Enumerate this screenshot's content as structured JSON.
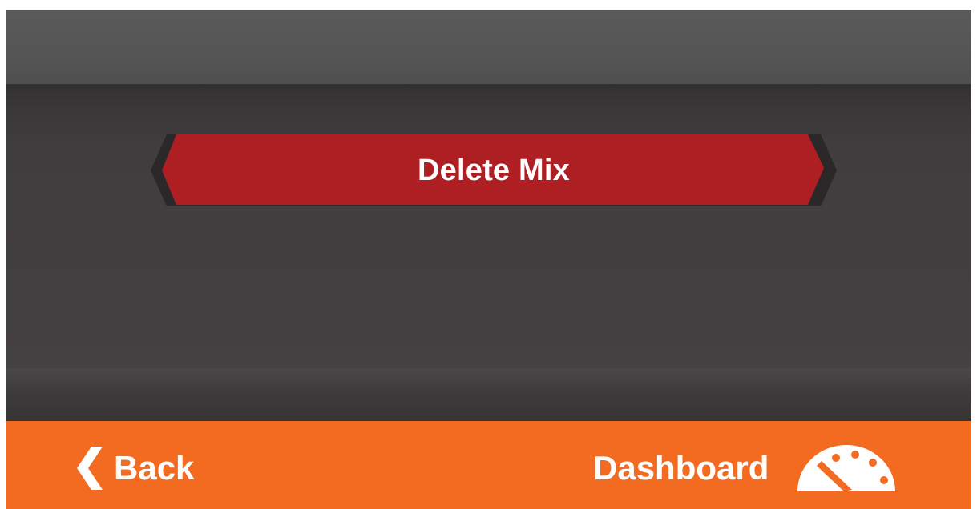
{
  "main": {
    "delete_label": "Delete Mix"
  },
  "footer": {
    "back_label": "Back",
    "dashboard_label": "Dashboard"
  },
  "colors": {
    "accent_orange": "#f26b21",
    "danger_red": "#ae1f24",
    "panel_dark": "#403d3e"
  },
  "icons": {
    "back": "chevron-left-icon",
    "dashboard": "speedometer-icon"
  }
}
